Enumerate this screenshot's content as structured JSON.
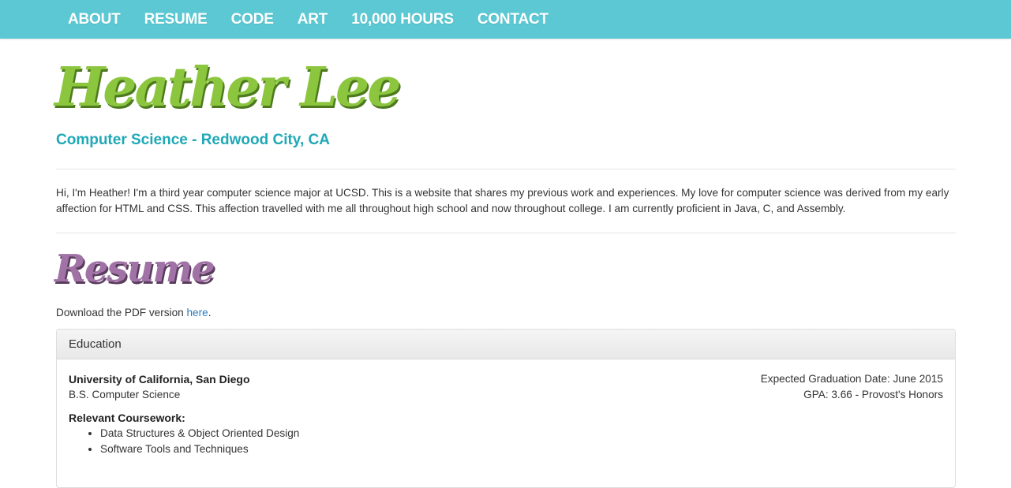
{
  "nav": {
    "items": [
      {
        "label": "ABOUT"
      },
      {
        "label": "RESUME"
      },
      {
        "label": "CODE"
      },
      {
        "label": "ART"
      },
      {
        "label": "10,000 HOURS"
      },
      {
        "label": "CONTACT"
      }
    ]
  },
  "header": {
    "name": "Heather Lee",
    "subtitle": "Computer Science - Redwood City, CA"
  },
  "intro": {
    "text": "Hi, I'm Heather! I'm a third year computer science major at UCSD. This is a website that shares my previous work and experiences. My love for computer science was derived from my early affection for HTML and CSS. This affection travelled with me all throughout high school and now throughout college. I am currently proficient in Java, C, and Assembly."
  },
  "resume": {
    "heading": "Resume",
    "download_prefix": "Download the PDF version ",
    "download_link": "here",
    "download_suffix": "."
  },
  "education": {
    "panel_title": "Education",
    "school": "University of California, San Diego",
    "degree": "B.S. Computer Science",
    "graduation": "Expected Graduation Date: June 2015",
    "gpa": "GPA: 3.66 - Provost's Honors",
    "coursework_label": "Relevant Coursework:",
    "courses": [
      "Data Structures & Object Oriented Design",
      "Software Tools and Techniques"
    ]
  },
  "colors": {
    "navbar": "#5bc8d3",
    "name": "#8cc63f",
    "subtitle": "#1fa8b6",
    "section_heading": "#a172a6",
    "link": "#2a7ab8"
  }
}
